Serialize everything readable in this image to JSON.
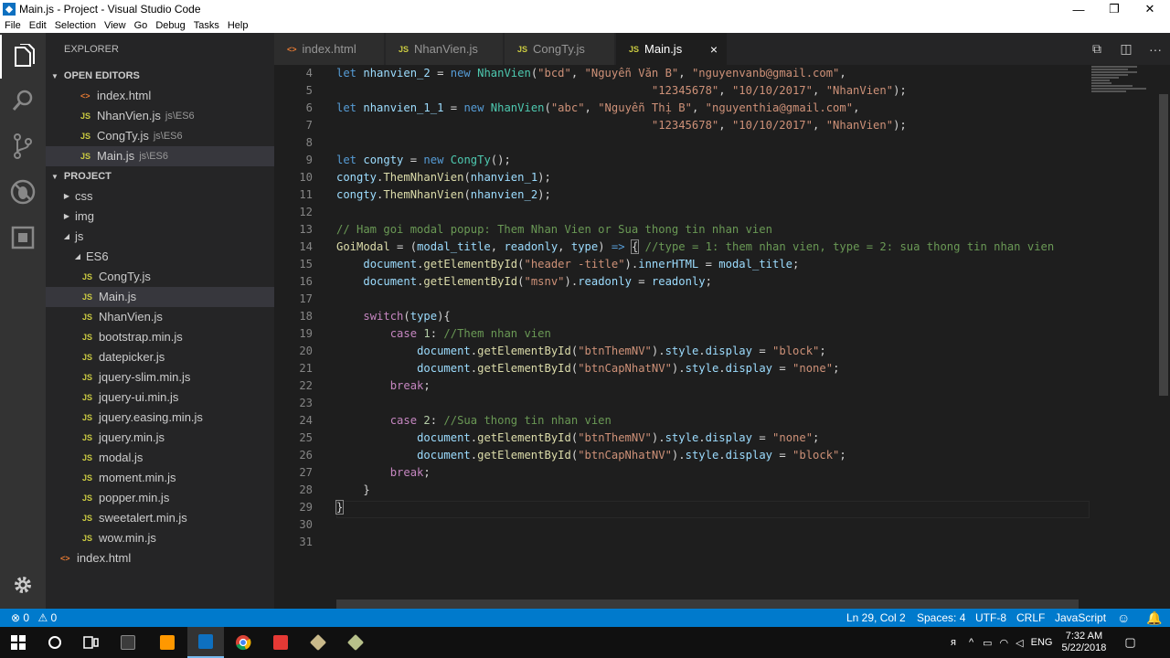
{
  "window": {
    "title": "Main.js - Project - Visual Studio Code",
    "minimize_glyph": "—",
    "maximize_glyph": "❐",
    "close_glyph": "✕"
  },
  "menu": [
    "File",
    "Edit",
    "Selection",
    "View",
    "Go",
    "Debug",
    "Tasks",
    "Help"
  ],
  "activity_icons": [
    "files-icon",
    "search-icon",
    "source-control-icon",
    "debug-icon",
    "extensions-icon",
    "settings-gear-icon"
  ],
  "explorer": {
    "header": "EXPLORER",
    "open_editors_title": "OPEN EDITORS",
    "open_editors": [
      {
        "name": "index.html",
        "desc": "",
        "type": "html"
      },
      {
        "name": "NhanVien.js",
        "desc": "js\\ES6",
        "type": "js"
      },
      {
        "name": "CongTy.js",
        "desc": "js\\ES6",
        "type": "js"
      },
      {
        "name": "Main.js",
        "desc": "js\\ES6",
        "type": "js",
        "selected": true
      }
    ],
    "project_title": "PROJECT",
    "tree": [
      {
        "name": "css",
        "kind": "folder",
        "expanded": false,
        "depth": 0
      },
      {
        "name": "img",
        "kind": "folder",
        "expanded": false,
        "depth": 0
      },
      {
        "name": "js",
        "kind": "folder",
        "expanded": true,
        "depth": 0
      },
      {
        "name": "ES6",
        "kind": "folder",
        "expanded": true,
        "depth": 1
      },
      {
        "name": "CongTy.js",
        "kind": "js",
        "depth": 2
      },
      {
        "name": "Main.js",
        "kind": "js",
        "depth": 2,
        "selected": true
      },
      {
        "name": "NhanVien.js",
        "kind": "js",
        "depth": 2
      },
      {
        "name": "bootstrap.min.js",
        "kind": "js",
        "depth": 1
      },
      {
        "name": "datepicker.js",
        "kind": "js",
        "depth": 1
      },
      {
        "name": "jquery-slim.min.js",
        "kind": "js",
        "depth": 1
      },
      {
        "name": "jquery-ui.min.js",
        "kind": "js",
        "depth": 1
      },
      {
        "name": "jquery.easing.min.js",
        "kind": "js",
        "depth": 1
      },
      {
        "name": "jquery.min.js",
        "kind": "js",
        "depth": 1
      },
      {
        "name": "modal.js",
        "kind": "js",
        "depth": 1
      },
      {
        "name": "moment.min.js",
        "kind": "js",
        "depth": 1
      },
      {
        "name": "popper.min.js",
        "kind": "js",
        "depth": 1
      },
      {
        "name": "sweetalert.min.js",
        "kind": "js",
        "depth": 1
      },
      {
        "name": "wow.min.js",
        "kind": "js",
        "depth": 1
      },
      {
        "name": "index.html",
        "kind": "html",
        "depth": 0
      }
    ]
  },
  "tabs": [
    {
      "label": "index.html",
      "type": "html",
      "active": false
    },
    {
      "label": "NhanVien.js",
      "type": "js",
      "active": false
    },
    {
      "label": "CongTy.js",
      "type": "js",
      "active": false
    },
    {
      "label": "Main.js",
      "type": "js",
      "active": true
    }
  ],
  "icon_labels": {
    "js": "JS",
    "html": "<>",
    "close": "×"
  },
  "editor": {
    "first_line": 4,
    "lines": [
      [
        [
          "k",
          "let "
        ],
        [
          "v",
          "nhanvien_2"
        ],
        [
          "p",
          " = "
        ],
        [
          "k",
          "new "
        ],
        [
          "t",
          "NhanVien"
        ],
        [
          "p",
          "("
        ],
        [
          "s",
          "\"bcd\""
        ],
        [
          "p",
          ", "
        ],
        [
          "s",
          "\"Nguyễn Văn B\""
        ],
        [
          "p",
          ", "
        ],
        [
          "s",
          "\"nguyenvanb@gmail.com\""
        ],
        [
          "p",
          ","
        ]
      ],
      [
        [
          "p",
          "                                               "
        ],
        [
          "s",
          "\"12345678\""
        ],
        [
          "p",
          ", "
        ],
        [
          "s",
          "\"10/10/2017\""
        ],
        [
          "p",
          ", "
        ],
        [
          "s",
          "\"NhanVien\""
        ],
        [
          "p",
          ");"
        ]
      ],
      [
        [
          "k",
          "let "
        ],
        [
          "v",
          "nhanvien_1_1"
        ],
        [
          "p",
          " = "
        ],
        [
          "k",
          "new "
        ],
        [
          "t",
          "NhanVien"
        ],
        [
          "p",
          "("
        ],
        [
          "s",
          "\"abc\""
        ],
        [
          "p",
          ", "
        ],
        [
          "s",
          "\"Nguyễn Thị B\""
        ],
        [
          "p",
          ", "
        ],
        [
          "s",
          "\"nguyenthia@gmail.com\""
        ],
        [
          "p",
          ","
        ]
      ],
      [
        [
          "p",
          "                                               "
        ],
        [
          "s",
          "\"12345678\""
        ],
        [
          "p",
          ", "
        ],
        [
          "s",
          "\"10/10/2017\""
        ],
        [
          "p",
          ", "
        ],
        [
          "s",
          "\"NhanVien\""
        ],
        [
          "p",
          ");"
        ]
      ],
      [],
      [
        [
          "k",
          "let "
        ],
        [
          "v",
          "congty"
        ],
        [
          "p",
          " = "
        ],
        [
          "k",
          "new "
        ],
        [
          "t",
          "CongTy"
        ],
        [
          "p",
          "();"
        ]
      ],
      [
        [
          "v",
          "congty"
        ],
        [
          "p",
          "."
        ],
        [
          "f",
          "ThemNhanVien"
        ],
        [
          "p",
          "("
        ],
        [
          "v",
          "nhanvien_1"
        ],
        [
          "p",
          ");"
        ]
      ],
      [
        [
          "v",
          "congty"
        ],
        [
          "p",
          "."
        ],
        [
          "f",
          "ThemNhanVien"
        ],
        [
          "p",
          "("
        ],
        [
          "v",
          "nhanvien_2"
        ],
        [
          "p",
          ");"
        ]
      ],
      [],
      [
        [
          "c",
          "// Ham goi modal popup: Them Nhan Vien or Sua thong tin nhan vien"
        ]
      ],
      [
        [
          "f",
          "GoiModal"
        ],
        [
          "p",
          " = ("
        ],
        [
          "v",
          "modal_title"
        ],
        [
          "p",
          ", "
        ],
        [
          "v",
          "readonly"
        ],
        [
          "p",
          ", "
        ],
        [
          "v",
          "type"
        ],
        [
          "p",
          ") "
        ],
        [
          "k",
          "=>"
        ],
        [
          "p",
          " "
        ],
        [
          "pb",
          "{"
        ],
        [
          "p",
          " "
        ],
        [
          "c",
          "//type = 1: them nhan vien, type = 2: sua thong tin nhan vien"
        ]
      ],
      [
        [
          "p",
          "    "
        ],
        [
          "v",
          "document"
        ],
        [
          "p",
          "."
        ],
        [
          "f",
          "getElementById"
        ],
        [
          "p",
          "("
        ],
        [
          "s",
          "\"header -title\""
        ],
        [
          "p",
          ")."
        ],
        [
          "v",
          "innerHTML"
        ],
        [
          "p",
          " = "
        ],
        [
          "v",
          "modal_title"
        ],
        [
          "p",
          ";"
        ]
      ],
      [
        [
          "p",
          "    "
        ],
        [
          "v",
          "document"
        ],
        [
          "p",
          "."
        ],
        [
          "f",
          "getElementById"
        ],
        [
          "p",
          "("
        ],
        [
          "s",
          "\"msnv\""
        ],
        [
          "p",
          ")."
        ],
        [
          "v",
          "readonly"
        ],
        [
          "p",
          " = "
        ],
        [
          "v",
          "readonly"
        ],
        [
          "p",
          ";"
        ]
      ],
      [],
      [
        [
          "p",
          "    "
        ],
        [
          "ck",
          "switch"
        ],
        [
          "p",
          "("
        ],
        [
          "v",
          "type"
        ],
        [
          "p",
          "){"
        ]
      ],
      [
        [
          "p",
          "        "
        ],
        [
          "ck",
          "case "
        ],
        [
          "n",
          "1"
        ],
        [
          "p",
          ": "
        ],
        [
          "c",
          "//Them nhan vien"
        ]
      ],
      [
        [
          "p",
          "            "
        ],
        [
          "v",
          "document"
        ],
        [
          "p",
          "."
        ],
        [
          "f",
          "getElementById"
        ],
        [
          "p",
          "("
        ],
        [
          "s",
          "\"btnThemNV\""
        ],
        [
          "p",
          ")."
        ],
        [
          "v",
          "style"
        ],
        [
          "p",
          "."
        ],
        [
          "v",
          "display"
        ],
        [
          "p",
          " = "
        ],
        [
          "s",
          "\"block\""
        ],
        [
          "p",
          ";"
        ]
      ],
      [
        [
          "p",
          "            "
        ],
        [
          "v",
          "document"
        ],
        [
          "p",
          "."
        ],
        [
          "f",
          "getElementById"
        ],
        [
          "p",
          "("
        ],
        [
          "s",
          "\"btnCapNhatNV\""
        ],
        [
          "p",
          ")."
        ],
        [
          "v",
          "style"
        ],
        [
          "p",
          "."
        ],
        [
          "v",
          "display"
        ],
        [
          "p",
          " = "
        ],
        [
          "s",
          "\"none\""
        ],
        [
          "p",
          ";"
        ]
      ],
      [
        [
          "p",
          "        "
        ],
        [
          "ck",
          "break"
        ],
        [
          "p",
          ";"
        ]
      ],
      [],
      [
        [
          "p",
          "        "
        ],
        [
          "ck",
          "case "
        ],
        [
          "n",
          "2"
        ],
        [
          "p",
          ": "
        ],
        [
          "c",
          "//Sua thong tin nhan vien"
        ]
      ],
      [
        [
          "p",
          "            "
        ],
        [
          "v",
          "document"
        ],
        [
          "p",
          "."
        ],
        [
          "f",
          "getElementById"
        ],
        [
          "p",
          "("
        ],
        [
          "s",
          "\"btnThemNV\""
        ],
        [
          "p",
          ")."
        ],
        [
          "v",
          "style"
        ],
        [
          "p",
          "."
        ],
        [
          "v",
          "display"
        ],
        [
          "p",
          " = "
        ],
        [
          "s",
          "\"none\""
        ],
        [
          "p",
          ";"
        ]
      ],
      [
        [
          "p",
          "            "
        ],
        [
          "v",
          "document"
        ],
        [
          "p",
          "."
        ],
        [
          "f",
          "getElementById"
        ],
        [
          "p",
          "("
        ],
        [
          "s",
          "\"btnCapNhatNV\""
        ],
        [
          "p",
          ")."
        ],
        [
          "v",
          "style"
        ],
        [
          "p",
          "."
        ],
        [
          "v",
          "display"
        ],
        [
          "p",
          " = "
        ],
        [
          "s",
          "\"block\""
        ],
        [
          "p",
          ";"
        ]
      ],
      [
        [
          "p",
          "        "
        ],
        [
          "ck",
          "break"
        ],
        [
          "p",
          ";"
        ]
      ],
      [
        [
          "p",
          "    }"
        ]
      ],
      [
        [
          "pb",
          "}"
        ]
      ],
      [],
      []
    ]
  },
  "status": {
    "errors": "0",
    "warnings": "0",
    "position": "Ln 29, Col 2",
    "spaces": "Spaces: 4",
    "encoding": "UTF-8",
    "eol": "CRLF",
    "language": "JavaScript"
  },
  "taskbar": {
    "apps": [
      "windows-start-icon",
      "cortana-circle-icon",
      "task-view-icon",
      "snipping-tool-icon",
      "sublime-text-icon",
      "vscode-icon",
      "chrome-icon",
      "xmind-icon",
      "package-icon",
      "package-icon-2"
    ],
    "lang": "ENG",
    "time": "7:32 AM",
    "date": "5/22/2018"
  },
  "colors": {
    "accent": "#007acc",
    "sidebar": "#252526",
    "editor": "#1e1e1e",
    "activity": "#333333"
  }
}
